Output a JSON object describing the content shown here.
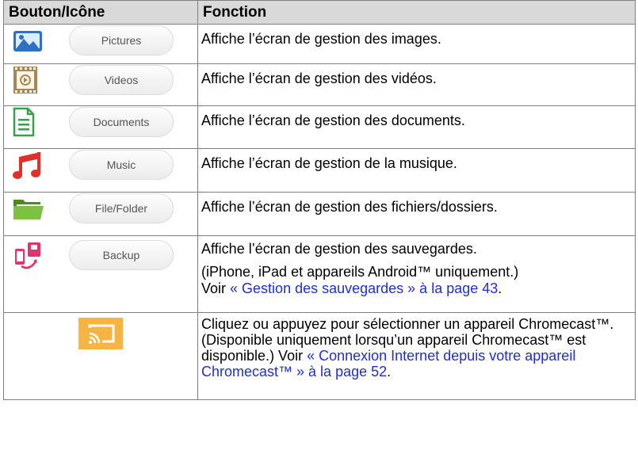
{
  "header": {
    "col1": "Bouton/Icône",
    "col2": "Fonction"
  },
  "rows": [
    {
      "icon": "pictures-icon",
      "button": "Pictures",
      "text": "Affiche l’écran de gestion des images."
    },
    {
      "icon": "videos-icon",
      "button": "Videos",
      "text": "Affiche l’écran de gestion des vidéos."
    },
    {
      "icon": "documents-icon",
      "button": "Documents",
      "text": "Affiche l’écran de gestion des documents."
    },
    {
      "icon": "music-icon",
      "button": "Music",
      "text": "Affiche l’écran de gestion de la musique."
    },
    {
      "icon": "folder-icon",
      "button": "File/Folder",
      "text": "Affiche l’écran de gestion des fichiers/dossiers."
    },
    {
      "icon": "backup-icon",
      "button": "Backup",
      "text": "Affiche l’écran de gestion des sauvegardes.",
      "note": "(iPhone, iPad et appareils Android™ uniquement.)",
      "see": "Voir ",
      "link": "« Gestion des sauvegardes » à la page 43",
      "after": "."
    }
  ],
  "cast_row": {
    "icon": "cast-icon",
    "text": "Cliquez ou appuyez pour sélectionner un appareil Chromecast™. (Disponible uniquement lorsqu’un appareil Chromecast™ est disponible.) Voir",
    "link": "« Connexion Internet depuis votre appareil Chromecast™ » à la page 52",
    "after": "."
  },
  "colors": {
    "header_bg": "#d9d9d9",
    "link": "#1f2fd0",
    "cast_bg": "#f6b445"
  }
}
